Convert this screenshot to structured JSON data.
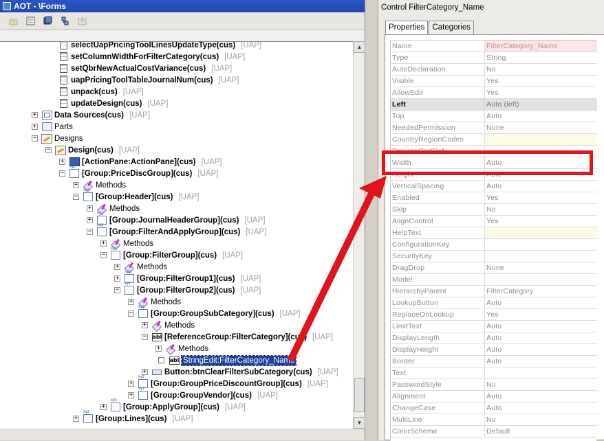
{
  "aot": {
    "title": "AOT - \\Forms",
    "toolbar": [
      {
        "name": "open-icon",
        "enabled": false
      },
      {
        "name": "properties-icon",
        "enabled": true
      },
      {
        "name": "save-all-icon",
        "enabled": true
      },
      {
        "name": "compile-icon",
        "enabled": true
      },
      {
        "name": "import-icon",
        "enabled": false
      }
    ]
  },
  "tree": {
    "rows": [
      {
        "label": "selectUapPricingToolLinesUpdateType(cus)",
        "tag": "[UAP]"
      },
      {
        "label": "setColumnWidthForFilterCategory(cus)",
        "tag": "[UAP]"
      },
      {
        "label": "setQbrNewActualCostVariance(cus)",
        "tag": "[UAP]"
      },
      {
        "label": "uapPricingToolTableJournalNum(cus)",
        "tag": "[UAP]"
      },
      {
        "label": "unpack(cus)",
        "tag": "[UAP]"
      },
      {
        "label": "updateDesign(cus)",
        "tag": "[UAP]"
      },
      {
        "label": "Data Sources(cus)",
        "tag": "[UAP]",
        "exp": "+"
      },
      {
        "label": "Parts",
        "tag": "",
        "exp": "+"
      },
      {
        "label": "Designs",
        "tag": "",
        "exp": "−"
      },
      {
        "label": "Design(cus)",
        "tag": "[UAP]",
        "exp": "−"
      },
      {
        "label": "[ActionPane:ActionPane](cus)",
        "tag": "[UAP]",
        "exp": "+"
      },
      {
        "label": "[Group:PriceDiscGroup](cus)",
        "tag": "[UAP]",
        "exp": "−"
      },
      {
        "label": "Methods",
        "tag": "",
        "exp": "+"
      },
      {
        "label": "[Group:Header](cus)",
        "tag": "[UAP]",
        "exp": "−"
      },
      {
        "label": "Methods",
        "tag": "",
        "exp": "+"
      },
      {
        "label": "[Group:JournalHeaderGroup](cus)",
        "tag": "[UAP]",
        "exp": "+"
      },
      {
        "label": "[Group:FilterAndApplyGroup](cus)",
        "tag": "[UAP]",
        "exp": "−"
      },
      {
        "label": "Methods",
        "tag": "",
        "exp": "+"
      },
      {
        "label": "[Group:FilterGroup](cus)",
        "tag": "[UAP]",
        "exp": "−"
      },
      {
        "label": "Methods",
        "tag": "",
        "exp": "+"
      },
      {
        "label": "[Group:FilterGroup1](cus)",
        "tag": "[UAP]",
        "exp": "+"
      },
      {
        "label": "[Group:FilterGroup2](cus)",
        "tag": "[UAP]",
        "exp": "−"
      },
      {
        "label": "Methods",
        "tag": "",
        "exp": "+"
      },
      {
        "label": "[Group:GroupSubCategory](cus)",
        "tag": "[UAP]",
        "exp": "−"
      },
      {
        "label": "Methods",
        "tag": "",
        "exp": "+"
      },
      {
        "label": "[ReferenceGroup:FilterCategory](cus)",
        "tag": "[UAP]",
        "exp": "−"
      },
      {
        "label": "Methods",
        "tag": "",
        "exp": "+"
      },
      {
        "label": "StringEdit:FilterCategory_Name",
        "tag": "",
        "exp": ""
      },
      {
        "label": "Button:btnClearFilterSubCategory(cus)",
        "tag": "[UAP]",
        "exp": "+"
      },
      {
        "label": "[Group:GroupPriceDiscountGroup](cus)",
        "tag": "[UAP]",
        "exp": "+"
      },
      {
        "label": "[Group:GroupVendor](cus)",
        "tag": "[UAP]",
        "exp": "+"
      },
      {
        "label": "[Group:ApplyGroup](cus)",
        "tag": "[UAP]",
        "exp": "+"
      },
      {
        "label": "[Group:Lines](cus)",
        "tag": "[UAP]",
        "exp": "+"
      }
    ]
  },
  "props": {
    "title": "Control FilterCategory_Name",
    "tabs": [
      "Properties",
      "Categories"
    ],
    "rows": [
      {
        "name": "Name",
        "value": "FilterCategory_Name"
      },
      {
        "name": "Type",
        "value": "String"
      },
      {
        "name": "AutoDeclaration",
        "value": "No"
      },
      {
        "name": "Visible",
        "value": "Yes"
      },
      {
        "name": "AllowEdit",
        "value": "Yes"
      },
      {
        "name": "Left",
        "value": "Auto (left)"
      },
      {
        "name": "Top",
        "value": "Auto"
      },
      {
        "name": "NeededPermission",
        "value": "None"
      },
      {
        "name": "CountryRegionCodes",
        "value": ""
      },
      {
        "name": "PreviewPartRef",
        "value": ""
      },
      {
        "name": "Width",
        "value": "Auto"
      },
      {
        "name": "Height",
        "value": "Auto"
      },
      {
        "name": "VerticalSpacing",
        "value": "Auto"
      },
      {
        "name": "Enabled",
        "value": "Yes"
      },
      {
        "name": "Skip",
        "value": "No"
      },
      {
        "name": "AlignControl",
        "value": "Yes"
      },
      {
        "name": "HelpText",
        "value": ""
      },
      {
        "name": "ConfigurationKey",
        "value": ""
      },
      {
        "name": "SecurityKey",
        "value": ""
      },
      {
        "name": "DragDrop",
        "value": "None"
      },
      {
        "name": "Model",
        "value": ""
      },
      {
        "name": "HierarchyParent",
        "value": "FilterCategory"
      },
      {
        "name": "LookupButton",
        "value": "Auto"
      },
      {
        "name": "ReplaceOnLookup",
        "value": "Yes"
      },
      {
        "name": "LimitText",
        "value": "Auto"
      },
      {
        "name": "DisplayLength",
        "value": "Auto"
      },
      {
        "name": "DisplayHeight",
        "value": "Auto"
      },
      {
        "name": "Border",
        "value": "Auto"
      },
      {
        "name": "Text",
        "value": ""
      },
      {
        "name": "PasswordStyle",
        "value": "No"
      },
      {
        "name": "Alignment",
        "value": "Auto"
      },
      {
        "name": "ChangeCase",
        "value": "Auto"
      },
      {
        "name": "MultiLine",
        "value": "No"
      },
      {
        "name": "ColorScheme",
        "value": "Default"
      }
    ]
  },
  "annotation": {
    "highlight_color": "#e0141a",
    "highlighted_property": "Width"
  },
  "colors": {
    "selection": "#1d3fa0",
    "tag_gray": "#a0a0a0",
    "titlebar": "#2147a8"
  }
}
